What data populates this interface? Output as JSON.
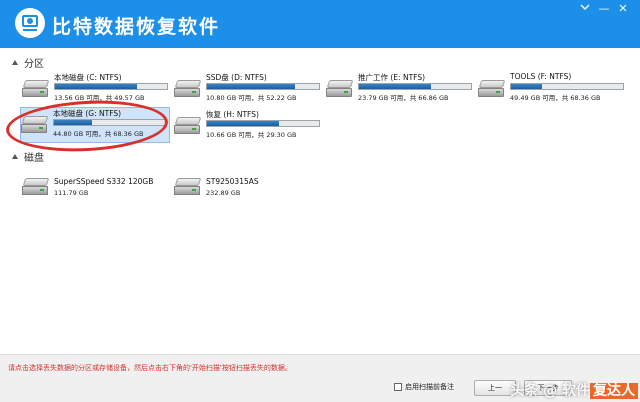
{
  "window": {
    "title": "比特数据恢复软件",
    "colors": {
      "titlebar": "#1c90e8",
      "hint": "#d9302b",
      "bar_fill": "#1a5f9e"
    },
    "icons": [
      "drive-logo-icon",
      "restore-icon",
      "minimize-icon",
      "close-icon"
    ],
    "minimize_glyph": "—",
    "close_glyph": "✕"
  },
  "partitions": {
    "header": "分区",
    "items": [
      {
        "name": "本地磁盘 (C: NTFS)",
        "size_text": "13.56 GB 可用，共 49.57 GB",
        "used_fraction": 0.73,
        "selected": false
      },
      {
        "name": "SSD盘 (D: NTFS)",
        "size_text": "10.80 GB 可用，共 52.22 GB",
        "used_fraction": 0.79,
        "selected": false
      },
      {
        "name": "推广工作 (E: NTFS)",
        "size_text": "23.79 GB 可用，共 66.86 GB",
        "used_fraction": 0.64,
        "selected": false
      },
      {
        "name": "TOOLS (F: NTFS)",
        "size_text": "49.49 GB 可用，共 68.36 GB",
        "used_fraction": 0.28,
        "selected": false
      },
      {
        "name": "本地磁盘 (G: NTFS)",
        "size_text": "44.80 GB 可用，共 68.36 GB",
        "used_fraction": 0.34,
        "selected": true
      },
      {
        "name": "恢复 (H: NTFS)",
        "size_text": "10.66 GB 可用，共 29.30 GB",
        "used_fraction": 0.64,
        "selected": false
      }
    ]
  },
  "disks": {
    "header": "磁盘",
    "items": [
      {
        "name": "SuperSSpeed S332 120GB",
        "size_text": "111.79 GB"
      },
      {
        "name": "ST9250315AS",
        "size_text": "232.89 GB"
      }
    ]
  },
  "footer": {
    "hint": "请点击选择丢失数据的分区或存储设备，然后点击右下角的'开始扫描'按钮扫描丢失的数据。",
    "checkbox_label": "启用扫描前备注",
    "btn_prev": "上一",
    "btn_next": "下一步",
    "watermark_plain": "头条 @ 软件",
    "watermark_highlight": "复达人"
  }
}
